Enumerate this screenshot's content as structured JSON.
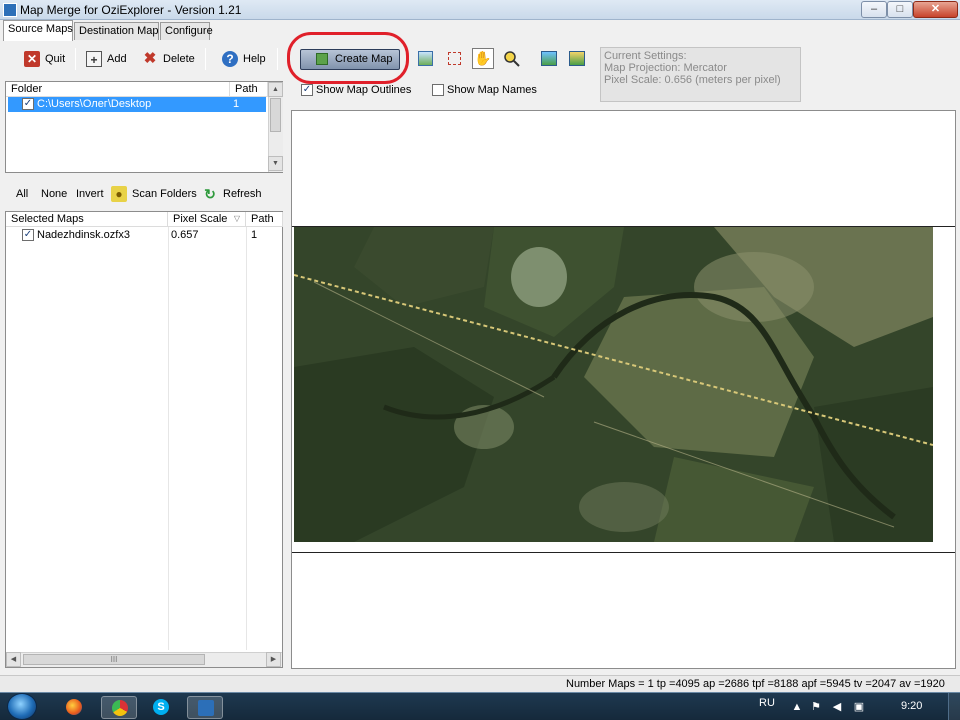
{
  "window": {
    "title": "Map Merge for OziExplorer - Version 1.21"
  },
  "tabs": [
    "Source Maps",
    "Destination Map",
    "Configure"
  ],
  "toolbar": {
    "quit": "Quit",
    "add": "Add",
    "delete": "Delete",
    "help": "Help",
    "create_map": "Create Map"
  },
  "view_options": {
    "show_map_outlines": "Show Map Outlines",
    "show_map_names": "Show Map Names"
  },
  "current_settings": {
    "title": "Current Settings:",
    "projection": "Map Projection: Mercator",
    "pixel_scale": "Pixel Scale: 0.656 (meters per pixel)"
  },
  "folders": {
    "col_folder": "Folder",
    "col_path": "Path",
    "rows": [
      {
        "folder": "C:\\Users\\Олег\\Desktop",
        "path": "1",
        "checked": true
      }
    ]
  },
  "map_actions": {
    "all": "All",
    "none": "None",
    "invert": "Invert",
    "scan_folders": "Scan Folders",
    "refresh": "Refresh"
  },
  "selected_maps": {
    "col_name": "Selected Maps",
    "col_scale": "Pixel Scale",
    "col_path": "Path",
    "rows": [
      {
        "name": "Nadezhdinsk.ozfx3",
        "scale": "0.657",
        "path": "1",
        "checked": true
      }
    ]
  },
  "statusbar": {
    "text": "Number Maps = 1   tp =4095  ap =2686  tpf =8188  apf =5945  tv =2047  av =1920"
  },
  "taskbar": {
    "language": "RU",
    "time": "9:20"
  },
  "colors": {
    "highlight": "#e0202a",
    "selection": "#3399ff",
    "map_forest": "#2f4423",
    "map_field": "#5d6b45",
    "road": "#d8c878"
  }
}
